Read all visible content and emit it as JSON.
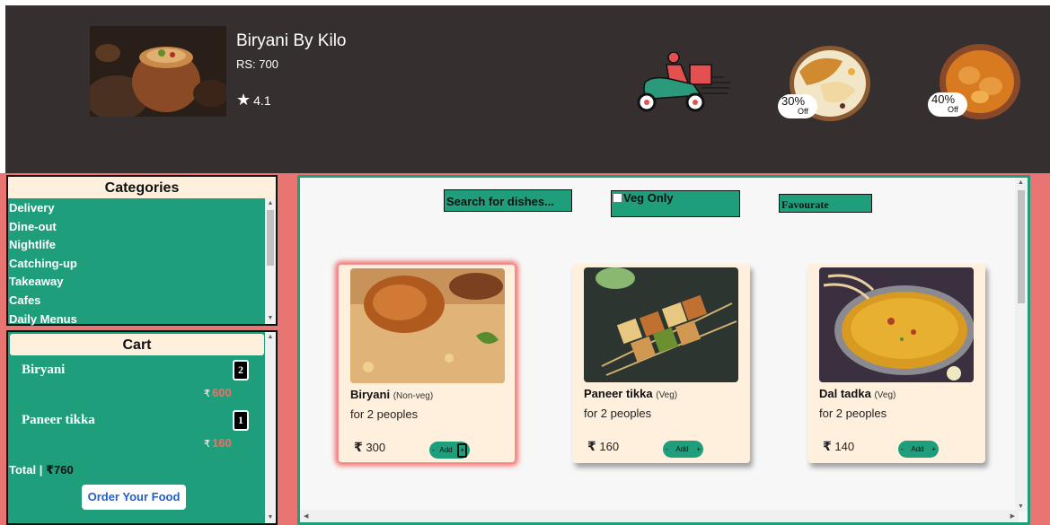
{
  "header": {
    "restaurant_name": "Biryani By Kilo",
    "price": "RS: 700",
    "rating": "4.1",
    "offers": [
      {
        "percent": "30%",
        "label": "Off"
      },
      {
        "percent": "40%",
        "label": "Off"
      }
    ]
  },
  "categories": {
    "title": "Categories",
    "items": [
      "Delivery",
      "Dine-out",
      "Nightlife",
      "Catching-up",
      "Takeaway",
      "Cafes",
      "Daily Menus"
    ]
  },
  "cart": {
    "title": "Cart",
    "items": [
      {
        "name": "Biryani",
        "qty": "2",
        "currency": "₹",
        "price": "600"
      },
      {
        "name": "Paneer tikka",
        "qty": "1",
        "currency": "₹",
        "price": "160"
      }
    ],
    "total_label": "Total |",
    "total_currency": "₹",
    "total_amount": "760",
    "order_button": "Order Your Food"
  },
  "toolbar": {
    "search_placeholder": "Search for dishes...",
    "veg_only": "Veg Only",
    "favourate": "Favourate"
  },
  "dishes": [
    {
      "name": "Biryani",
      "tag": "(Non-veg)",
      "serves": "for 2 peoples",
      "currency": "₹",
      "price": "300",
      "add": "Add",
      "minus": "-",
      "plus": "+"
    },
    {
      "name": "Paneer tikka",
      "tag": "(Veg)",
      "serves": "for 2 peoples",
      "currency": "₹",
      "price": "160",
      "add": "Add",
      "minus": "-",
      "plus": "+"
    },
    {
      "name": "Dal tadka",
      "tag": "(Veg)",
      "serves": "for 2 peoples",
      "currency": "₹",
      "price": "140",
      "add": "Add",
      "minus": "-",
      "plus": "+"
    }
  ],
  "colors": {
    "header_bg": "#362f2f",
    "accent_green": "#1f9e7c",
    "salmon": "#e87572",
    "cream": "#fff0de"
  }
}
